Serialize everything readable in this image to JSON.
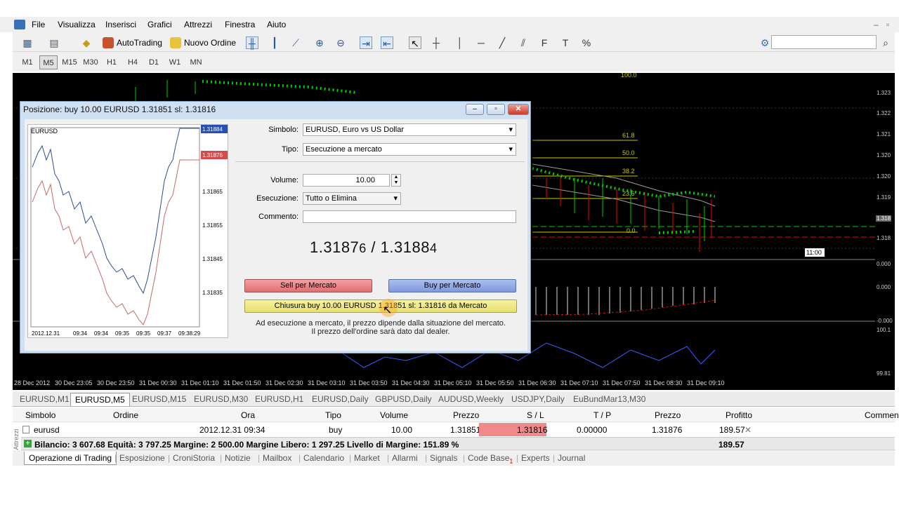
{
  "menu": [
    "File",
    "Visualizza",
    "Inserisci",
    "Grafici",
    "Attrezzi",
    "Finestra",
    "Aiuto"
  ],
  "toolbar": {
    "autotrading": "AutoTrading",
    "new_order": "Nuovo Ordine"
  },
  "timeframes": [
    "M1",
    "M5",
    "M15",
    "M30",
    "H1",
    "H4",
    "D1",
    "W1",
    "MN"
  ],
  "active_timeframe": "M5",
  "chart": {
    "y_ticks": [
      "1.323",
      "1.322",
      "1.321",
      "1.320",
      "1.320",
      "1.319",
      "1.318",
      "1.318",
      "0.000",
      "0.000",
      "-0.000",
      "100.1",
      "99.81"
    ],
    "fib_levels": [
      "100.0",
      "61.8",
      "50.0",
      "38.2",
      "23.6",
      "0.0"
    ],
    "x_ticks": [
      "28 Dec 2012",
      "30 Dec 23:05",
      "30 Dec 23:50",
      "31 Dec 00:30",
      "31 Dec 01:10",
      "31 Dec 01:50",
      "31 Dec 02:30",
      "31 Dec 03:10",
      "31 Dec 03:50",
      "31 Dec 04:30",
      "31 Dec 05:10",
      "31 Dec 05:50",
      "31 Dec 06:30",
      "31 Dec 07:10",
      "31 Dec 07:50",
      "31 Dec 08:30",
      "31 Dec 09:10"
    ],
    "time_marker": "11:00"
  },
  "dialog": {
    "title": "Posizione: buy 10.00 EURUSD 1.31851 sl: 1.31816",
    "mini_chart": {
      "symbol": "EURUSD",
      "price_top": "1.31884",
      "price_red": "1.31876",
      "y_ticks": [
        "1.31865",
        "1.31855",
        "1.31845",
        "1.31835"
      ],
      "x_ticks": [
        "2012.12.31",
        "09:34",
        "09:34",
        "09:35",
        "09:35",
        "09:37",
        "09:38:29"
      ]
    },
    "labels": {
      "symbol": "Simbolo:",
      "type": "Tipo:",
      "volume": "Volume:",
      "execution": "Esecuzione:",
      "comment": "Commento:"
    },
    "values": {
      "symbol": "EURUSD, Euro vs US Dollar",
      "type": "Esecuzione a mercato",
      "volume": "10.00",
      "execution": "Tutto o Elimina",
      "comment": ""
    },
    "quote": {
      "bid_main": "1.3187",
      "bid_small": "6",
      "sep": " / ",
      "ask_main": "1.3188",
      "ask_small": "4"
    },
    "buttons": {
      "sell": "Sell per Mercato",
      "buy": "Buy per Mercato",
      "close": "Chiusura buy 10.00 EURUSD 1.31851 sl: 1.31816 da Mercato"
    },
    "note": [
      "Ad esecuzione a mercato, il prezzo dipende dalla situazione del mercato.",
      "Il prezzo dell'ordine sarà dato dal dealer."
    ]
  },
  "symbol_tabs": [
    "EURUSD,M1",
    "EURUSD,M5",
    "EURUSD,M15",
    "EURUSD,M30",
    "EURUSD,H1",
    "EURUSD,Daily",
    "GBPUSD,Daily",
    "AUDUSD,Weekly",
    "USDJPY,Daily",
    "EuBundMar13,M30"
  ],
  "active_symbol_tab": "EURUSD,M5",
  "trade_table": {
    "headers": [
      "Simbolo",
      "Ordine",
      "Ora",
      "Tipo",
      "Volume",
      "Prezzo",
      "S / L",
      "T / P",
      "Prezzo",
      "Profitto",
      "Commen"
    ],
    "row": [
      "eurusd",
      "",
      "2012.12.31 09:34",
      "buy",
      "10.00",
      "1.31851",
      "1.31816",
      "0.00000",
      "1.31876",
      "189.57"
    ],
    "summary": "Bilancio: 3 607.68  Equità: 3 797.25  Margine: 2 500.00  Margine Libero: 1 297.25  Livello di Margine: 151.89 %",
    "summary_profit": "189.57",
    "sl_color": "#f08a8a"
  },
  "bottom_tabs": [
    "Operazione di Trading",
    "Esposizione",
    "CroniStoria",
    "Notizie",
    "Mailbox",
    "Calendario",
    "Market",
    "Allarmi",
    "Signals",
    "Code Base",
    "Experts",
    "Journal"
  ],
  "codebase_badge": "1",
  "side_label": "BoxAttrezzi"
}
